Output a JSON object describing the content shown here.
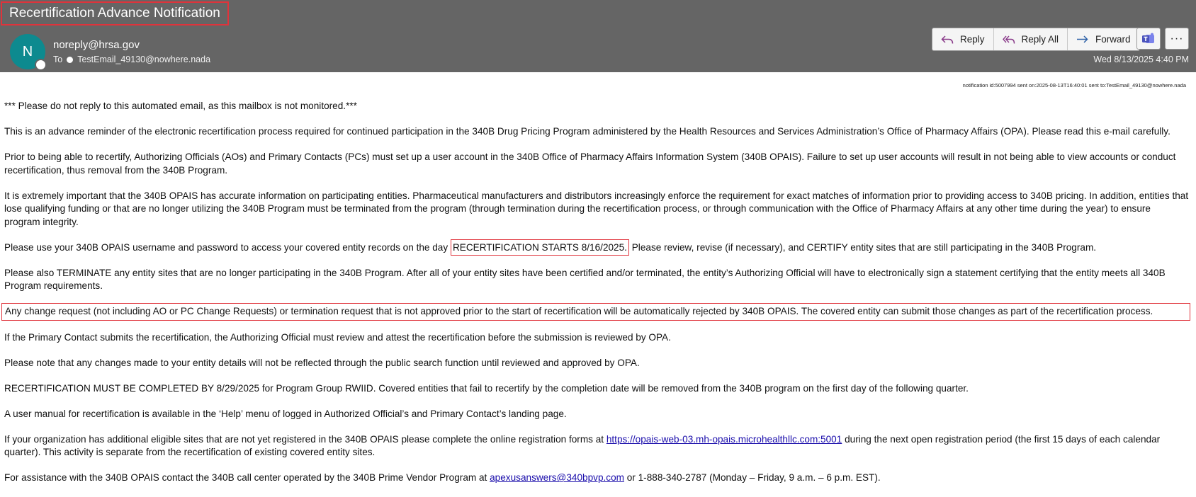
{
  "header": {
    "subject": "Recertification Advance Notification",
    "avatar_letter": "N",
    "sender": "noreply@hrsa.gov",
    "to_label": "To",
    "recipient": "TestEmail_49130@nowhere.nada",
    "date": "Wed 8/13/2025 4:40 PM",
    "actions": {
      "reply": "Reply",
      "reply_all": "Reply All",
      "forward": "Forward"
    },
    "more_label": "···"
  },
  "notification_meta": "notification id:5007994 sent on:2025-08-13T16:40:01 sent to:TestEmail_49130@nowhere.nada",
  "body": {
    "p1": "*** Please do not reply to this automated email, as this mailbox is not monitored.***",
    "p2": "This is an advance reminder of the electronic recertification process required for continued participation in the 340B Drug Pricing Program administered by the Health Resources and Services Administration’s Office of Pharmacy Affairs (OPA). Please read this e-mail carefully.",
    "p3": "Prior to being able to recertify, Authorizing Officials (AOs) and Primary Contacts (PCs) must set up a user account in the 340B Office of Pharmacy Affairs Information System (340B OPAIS). Failure to set up user accounts will result in not being able to view accounts or conduct recertification, thus removal from the 340B Program.",
    "p4": "It is extremely important that the 340B OPAIS has accurate information on participating entities. Pharmaceutical manufacturers and distributors increasingly enforce the requirement for exact matches of information prior to providing access to 340B pricing. In addition, entities that lose qualifying funding or that are no longer utilizing the 340B Program must be terminated from the program (through termination during the recertification process, or through communication with the Office of Pharmacy Affairs at any other time during the year) to ensure program integrity.",
    "p5_before": "Please use your 340B OPAIS username and password to access your covered entity records on the day ",
    "p5_highlight": "RECERTIFICATION STARTS 8/16/2025.",
    "p5_after": " Please review, revise (if necessary), and CERTIFY entity sites that are still participating in the 340B Program.",
    "p6": "Please also TERMINATE any entity sites that are no longer participating in the 340B Program. After all of your entity sites have been certified and/or terminated, the entity’s Authorizing Official will have to electronically sign a statement certifying that the entity meets all 340B Program requirements.",
    "p7": "Any change request (not including AO or PC Change Requests) or termination request that is not approved prior to the start of recertification will be automatically rejected by 340B OPAIS. The covered entity can submit those changes as part of the recertification process.",
    "p8": "If the Primary Contact submits the recertification, the Authorizing Official must review and attest the recertification before the submission is reviewed by OPA.",
    "p9": "Please note that any changes made to your entity details will not be reflected through the public search function until reviewed and approved by OPA.",
    "p10": "RECERTIFICATION MUST BE COMPLETED BY 8/29/2025 for Program Group RWIID. Covered entities that fail to recertify by the completion date will be removed from the 340B program on the first day of the following quarter.",
    "p11": "A user manual for recertification is available in the ‘Help’ menu of logged in Authorized Official’s and Primary Contact’s landing page.",
    "p12_before": "If your organization has additional eligible sites that are not yet registered in the 340B OPAIS please complete the online registration forms at ",
    "p12_link": "https://opais-web-03.mh-opais.microhealthllc.com:5001",
    "p12_after": " during the next open registration period (the first 15 days of each calendar quarter). This activity is separate from the recertification of existing covered entity sites.",
    "p13_before": "For assistance with the 340B OPAIS contact the 340B call center operated by the 340B Prime Vendor Program at ",
    "p13_link": "apexusanswers@340bpvp.com",
    "p13_after": " or 1-888-340-2787 (Monday – Friday, 9 a.m. – 6 p.m. EST)."
  }
}
